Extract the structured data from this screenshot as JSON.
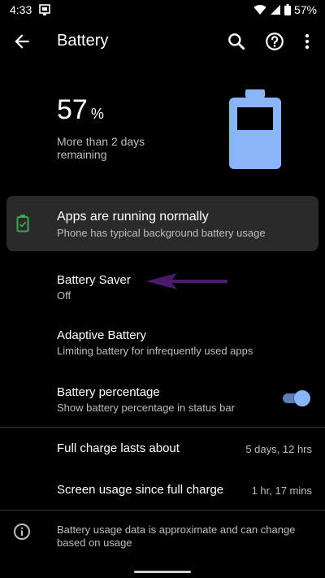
{
  "status_bar": {
    "time": "4:33",
    "battery_level": "57%"
  },
  "app_bar": {
    "title": "Battery",
    "icons": [
      "arrow-back-icon",
      "search-icon",
      "help-icon",
      "more-vert-icon"
    ]
  },
  "summary": {
    "percent_value": "57",
    "percent_sign": "%",
    "remaining": "More than 2 days remaining",
    "battery_fill_fraction": 0.57
  },
  "status_card": {
    "title": "Apps are running normally",
    "subtitle": "Phone has typical background battery usage",
    "icon": "battery-ok-icon"
  },
  "settings": {
    "battery_saver": {
      "title": "Battery Saver",
      "subtitle": "Off"
    },
    "adaptive_battery": {
      "title": "Adaptive Battery",
      "subtitle": "Limiting battery for infrequently used apps"
    },
    "battery_percentage": {
      "title": "Battery percentage",
      "subtitle": "Show battery percentage in status bar",
      "enabled": true
    }
  },
  "stats": {
    "full_charge": {
      "label": "Full charge lasts about",
      "value": "5 days, 12 hrs"
    },
    "screen_usage": {
      "label": "Screen usage since full charge",
      "value": "1 hr, 17 mins"
    }
  },
  "footer": {
    "info_text": "Battery usage data is approximate and can change based on usage"
  },
  "colors": {
    "accent": "#8ab4f8",
    "battery_graphic": "#8ab4f8",
    "card_background": "#2a2a2a",
    "ok_icon": "#34a853",
    "annotation_arrow": "#4a1a6e"
  }
}
